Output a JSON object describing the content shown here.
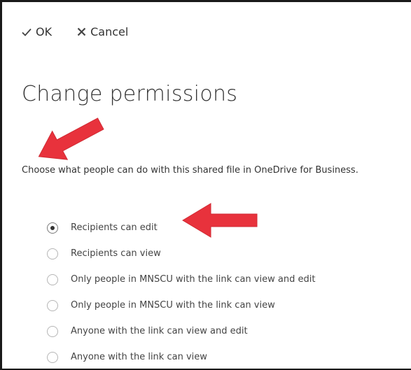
{
  "toolbar": {
    "ok_label": "OK",
    "cancel_label": "Cancel"
  },
  "page": {
    "title": "Change permissions",
    "description": "Choose what people can do with this shared file in OneDrive for Business."
  },
  "permission_options": [
    {
      "label": "Recipients can edit",
      "selected": true
    },
    {
      "label": "Recipients can view",
      "selected": false
    },
    {
      "label": "Only people in MNSCU with the link can view and edit",
      "selected": false
    },
    {
      "label": "Only people in MNSCU with the link can view",
      "selected": false
    },
    {
      "label": "Anyone with the link can view and edit",
      "selected": false
    },
    {
      "label": "Anyone with the link can view",
      "selected": false
    }
  ],
  "annotation_color": "#e8323c"
}
